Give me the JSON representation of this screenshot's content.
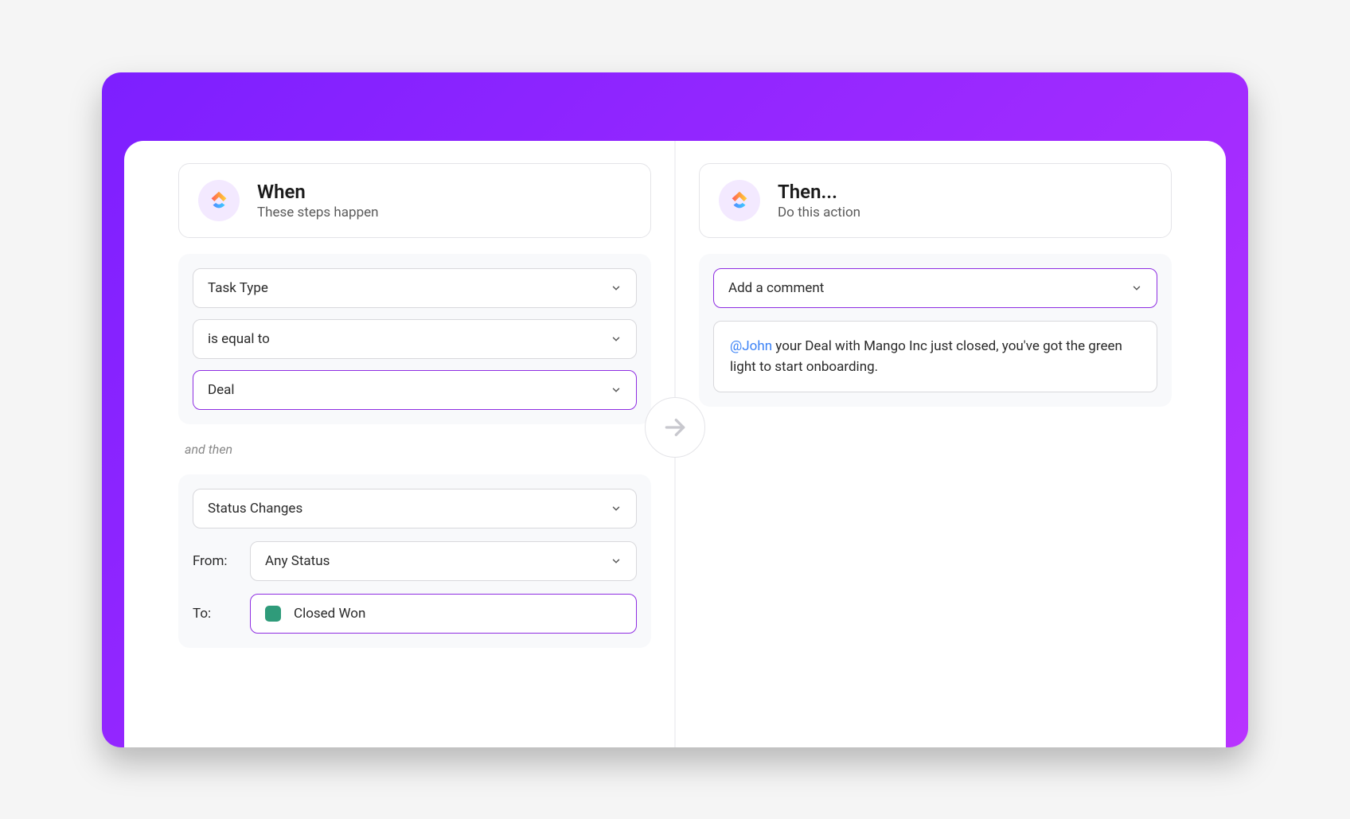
{
  "when": {
    "title": "When",
    "subtitle": "These steps happen",
    "taskType": "Task Type",
    "operator": "is equal to",
    "value": "Deal",
    "andThen": "and then",
    "statusChanges": "Status Changes",
    "fromLabel": "From:",
    "fromValue": "Any Status",
    "toLabel": "To:",
    "toValue": "Closed Won"
  },
  "then": {
    "title": "Then...",
    "subtitle": "Do this action",
    "action": "Add a comment",
    "commentMention": "@John",
    "commentText": " your Deal with Mango Inc just closed, you've got the green light to start onboarding."
  }
}
